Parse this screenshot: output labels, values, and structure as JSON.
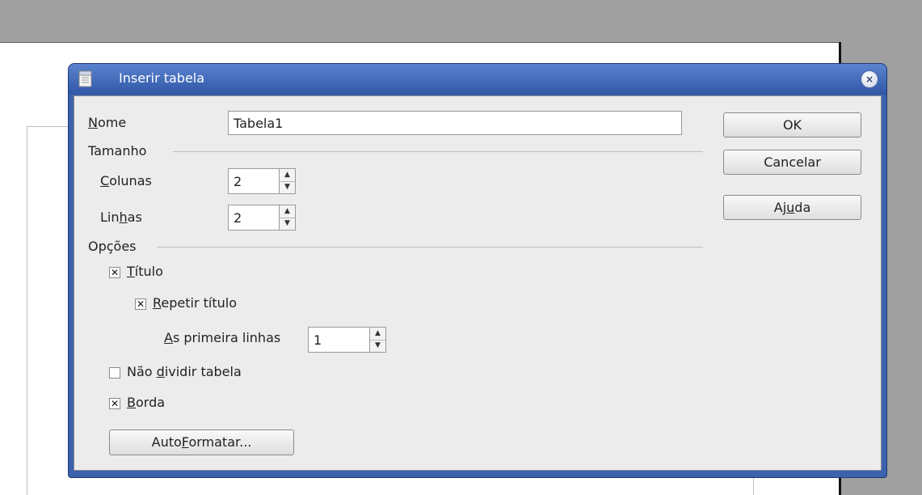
{
  "dialog": {
    "title": "Inserir tabela",
    "close_glyph": "×"
  },
  "form": {
    "name_label": {
      "mnemonic": "N",
      "rest": "ome"
    },
    "name_value": "Tabela1",
    "size_section": "Tamanho",
    "columns_label": {
      "mnemonic": "C",
      "rest": "olunas"
    },
    "columns_value": "2",
    "rows_label": {
      "pre": "Lin",
      "mnemonic": "h",
      "rest": "as"
    },
    "rows_value": "2",
    "options_section": "Opções",
    "heading": {
      "checked": true,
      "label": {
        "mnemonic": "T",
        "rest": "ítulo"
      }
    },
    "repeat_heading": {
      "checked": true,
      "label": {
        "mnemonic": "R",
        "rest": "epetir título"
      }
    },
    "first_rows": {
      "label": {
        "mnemonic": "A",
        "rest": "s primeira linhas"
      },
      "value": "1"
    },
    "dont_split": {
      "checked": false,
      "label": {
        "pre": "Não ",
        "mnemonic": "d",
        "rest": "ividir tabela"
      }
    },
    "border": {
      "checked": true,
      "label": {
        "mnemonic": "B",
        "rest": "orda"
      }
    },
    "autoformat_button": {
      "pre": "Auto",
      "mnemonic": "F",
      "rest": "ormatar..."
    }
  },
  "buttons": {
    "ok": "OK",
    "cancel": "Cancelar",
    "help": {
      "pre": "Aj",
      "mnemonic": "u",
      "rest": "da"
    }
  },
  "glyphs": {
    "check": "✕",
    "spin_up": "▲",
    "spin_down": "▼"
  },
  "colors": {
    "titlebar": "#3a62ad",
    "dialog_bg": "#ececec",
    "desktop_gray": "#a0a0a0"
  }
}
